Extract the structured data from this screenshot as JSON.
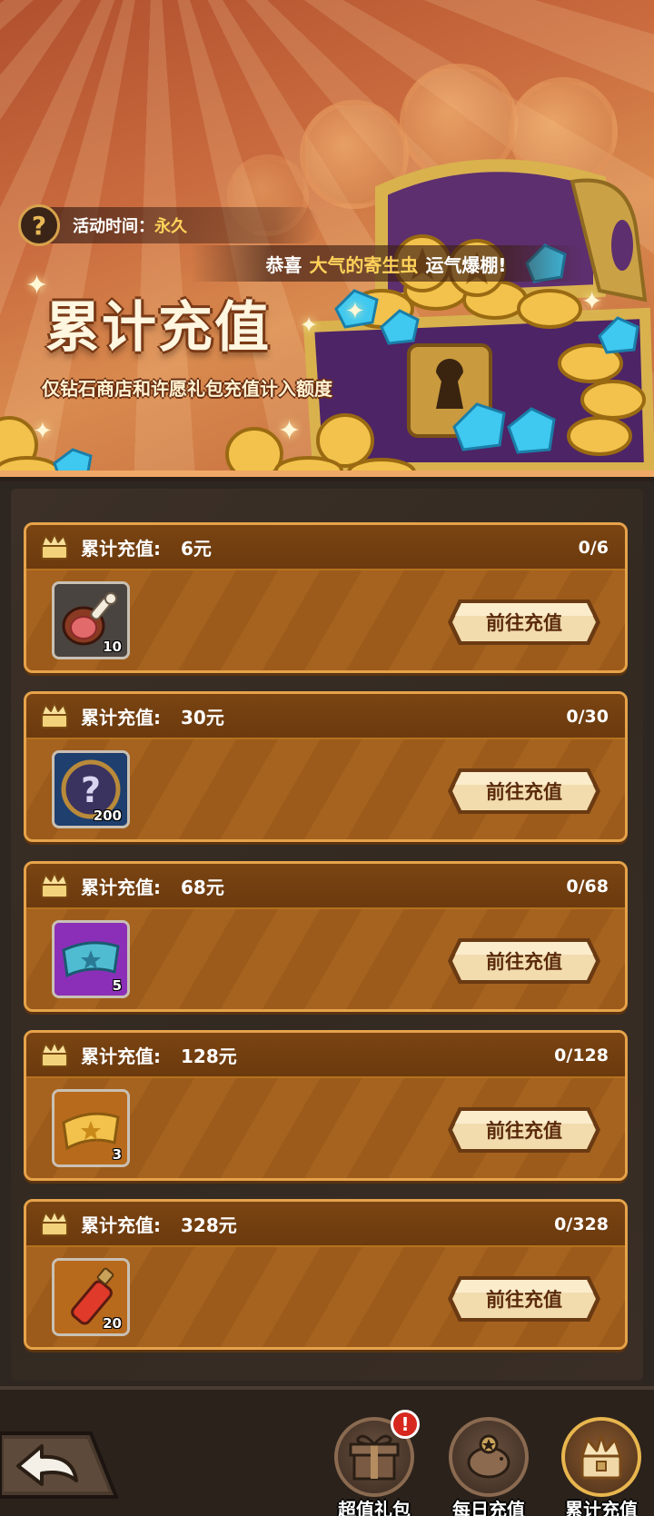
{
  "banner": {
    "time_label": "活动时间：",
    "time_value": "永久",
    "congrats_prefix": "恭喜",
    "congrats_name": "大气的寄生虫",
    "congrats_suffix": "运气爆棚!",
    "title": "累计充值",
    "subtitle": "仅钻石商店和许愿礼包充值计入额度"
  },
  "tiers": [
    {
      "label": "累计充值:",
      "amount": "6元",
      "progress": "0/6",
      "item_count": "10",
      "item_icon": "ham-leg-icon",
      "button": "前往充值"
    },
    {
      "label": "累计充值:",
      "amount": "30元",
      "progress": "0/30",
      "item_count": "200",
      "item_icon": "mystery-orb-icon",
      "button": "前往充值"
    },
    {
      "label": "累计充值:",
      "amount": "68元",
      "progress": "0/68",
      "item_count": "5",
      "item_icon": "blue-ticket-icon",
      "button": "前往充值"
    },
    {
      "label": "累计充值:",
      "amount": "128元",
      "progress": "0/128",
      "item_count": "3",
      "item_icon": "gold-ticket-icon",
      "button": "前往充值"
    },
    {
      "label": "累计充值:",
      "amount": "328元",
      "progress": "0/328",
      "item_count": "20",
      "item_icon": "red-potion-icon",
      "button": "前往充值"
    }
  ],
  "nav": {
    "tabs": [
      {
        "label": "超值礼包",
        "icon": "gift-box-icon",
        "badge": "!"
      },
      {
        "label": "每日充值",
        "icon": "piggy-bank-icon"
      },
      {
        "label": "累计充值",
        "icon": "crown-chest-icon",
        "active": true
      }
    ]
  },
  "colors": {
    "accent_gold": "#ffd25a",
    "card_border": "#e6a34a",
    "card_body": "#9a5a1c",
    "button_text": "#5a2a0c",
    "badge_red": "#d7281f"
  }
}
